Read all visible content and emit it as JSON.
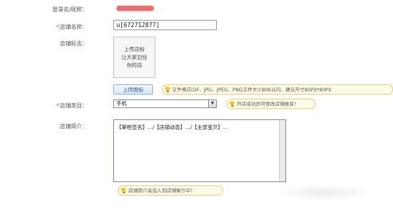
{
  "form": {
    "login_label": "登录名/昵称：",
    "shop_name": {
      "label": "店铺名称：",
      "value": "u[672712877]"
    },
    "shop_logo": {
      "label": "店铺标志：",
      "placeholder_text": "上传店标\n让大家记住\n你的店",
      "upload_button": "上传图标",
      "tip": "文件格式GIF、JPG、JPEG、PNG文件大小80K以内，建议尺寸80PX*80PX"
    },
    "shop_category": {
      "label": "店铺类目：",
      "selected": "手机",
      "tip": "开店成功后可修改店铺类目！"
    },
    "shop_intro": {
      "label": "店铺简介：",
      "value": "【掌柜签名】.../【店铺动态】.../【主营宝贝】...",
      "tip": "店铺简介会加入到店铺索引中！"
    }
  }
}
